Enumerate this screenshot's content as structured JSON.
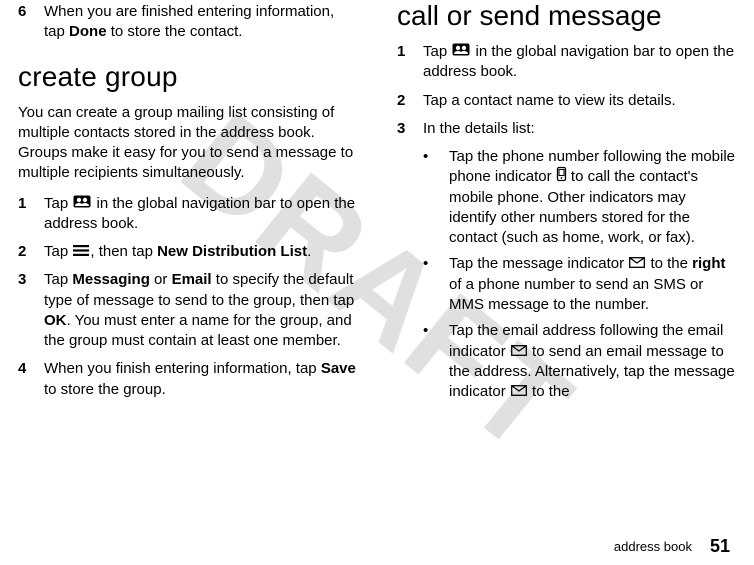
{
  "watermark": "DRAFT",
  "left": {
    "step6_num": "6",
    "step6_a": "When you are finished entering information, tap ",
    "step6_bold": "Done",
    "step6_b": " to store the contact.",
    "h_create": "create group",
    "para": "You can create a group mailing list consisting of multiple contacts stored in the address book. Groups make it easy for you to send a message to multiple recipients simultaneously.",
    "s1_num": "1",
    "s1_a": "Tap ",
    "s1_b": " in the global navigation bar to open the address book.",
    "s2_num": "2",
    "s2_a": "Tap ",
    "s2_b": ", then tap ",
    "s2_bold": "New Distribution List",
    "s2_c": ".",
    "s3_num": "3",
    "s3_a": "Tap ",
    "s3_bold1": "Messaging",
    "s3_b": " or ",
    "s3_bold2": "Email",
    "s3_c": " to specify the default type of message to send to the group, then tap ",
    "s3_bold3": "OK",
    "s3_d": ". You must enter a name for the group, and the group must contain at least one member.",
    "s4_num": "4",
    "s4_a": "When you finish entering information, tap ",
    "s4_bold": "Save",
    "s4_b": " to store the group."
  },
  "right": {
    "h_call": "call or send message",
    "s1_num": "1",
    "s1_a": "Tap ",
    "s1_b": " in the global navigation bar to open the address book.",
    "s2_num": "2",
    "s2_a": "Tap a contact name to view its details.",
    "s3_num": "3",
    "s3_a": "In the details list:",
    "b1_a": "Tap the phone number following the mobile phone indicator ",
    "b1_b": " to call the contact's mobile phone. Other indicators may identify other numbers stored for the contact (such as home, work, or fax).",
    "b2_a": "Tap the message indicator ",
    "b2_b": " to the ",
    "b2_bold": "right",
    "b2_c": " of a phone number to send an SMS or MMS message to the number.",
    "b3_a": "Tap the email address following the email indicator ",
    "b3_b": " to send an email message to the address. Alternatively, tap the message indicator ",
    "b3_c": " to the"
  },
  "footer_label": "address book",
  "footer_page": "51"
}
